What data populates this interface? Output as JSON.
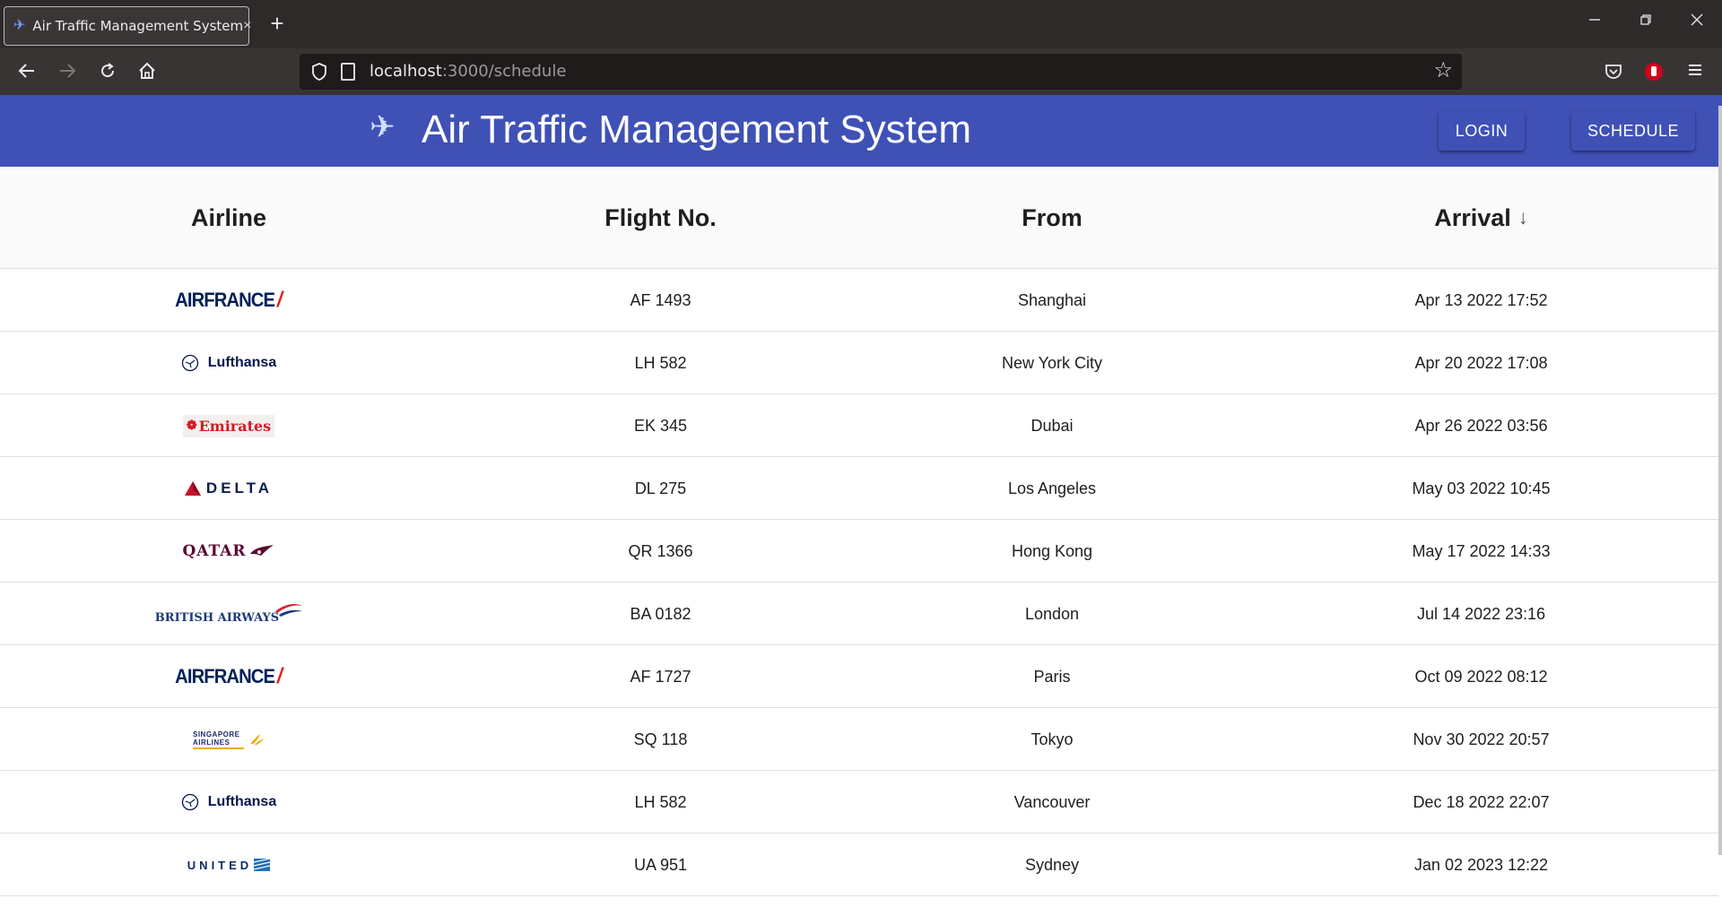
{
  "browser": {
    "tab_title": "Air Traffic Management System",
    "tab_close": "×",
    "new_tab": "+",
    "url_host": "localhost",
    "url_path": ":3000/schedule"
  },
  "app": {
    "title": "Air Traffic Management System",
    "login_label": "LOGIN",
    "schedule_label": "SCHEDULE",
    "brand_color": "#3f51b5"
  },
  "table": {
    "headers": [
      "Airline",
      "Flight No.",
      "From",
      "Arrival"
    ],
    "sort_indicator": "↓",
    "rows": [
      {
        "airline": "AIRFRANCE",
        "flight": "AF 1493",
        "from": "Shanghai",
        "arrival": "Apr 13 2022 17:52"
      },
      {
        "airline": "Lufthansa",
        "flight": "LH 582",
        "from": "New York City",
        "arrival": "Apr 20 2022 17:08"
      },
      {
        "airline": "Emirates",
        "flight": "EK 345",
        "from": "Dubai",
        "arrival": "Apr 26 2022 03:56"
      },
      {
        "airline": "DELTA",
        "flight": "DL 275",
        "from": "Los Angeles",
        "arrival": "May 03 2022 10:45"
      },
      {
        "airline": "QATAR",
        "flight": "QR 1366",
        "from": "Hong Kong",
        "arrival": "May 17 2022 14:33"
      },
      {
        "airline": "BRITISH AIRWAYS",
        "flight": "BA 0182",
        "from": "London",
        "arrival": "Jul 14 2022 23:16"
      },
      {
        "airline": "AIRFRANCE",
        "flight": "AF 1727",
        "from": "Paris",
        "arrival": "Oct 09 2022 08:12"
      },
      {
        "airline": "SINGAPORE AIRLINES",
        "flight": "SQ 118",
        "from": "Tokyo",
        "arrival": "Nov 30 2022 20:57"
      },
      {
        "airline": "Lufthansa",
        "flight": "LH 582",
        "from": "Vancouver",
        "arrival": "Dec 18 2022 22:07"
      },
      {
        "airline": "UNITED",
        "flight": "UA 951",
        "from": "Sydney",
        "arrival": "Jan 02 2023 12:22"
      }
    ]
  }
}
